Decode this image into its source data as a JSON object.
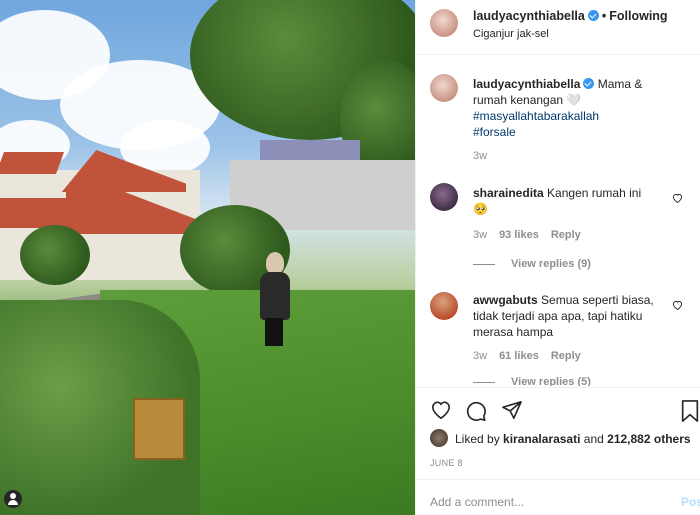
{
  "photo": {
    "alt_person_icon": "person-tag-icon"
  },
  "header": {
    "username": "laudyacynthiabella",
    "separator": "•",
    "follow_status": "Following",
    "location": "Ciganjur jak-sel"
  },
  "caption": {
    "username": "laudyacynthiabella",
    "text": "Mama & rumah kenangan 🤍",
    "hashtag1": "#masyallahtabarakallah",
    "hashtag2": "#forsale",
    "time": "3w"
  },
  "comments": [
    {
      "username": "sharainedita",
      "text": "Kangen rumah ini",
      "emoji": "🥺",
      "time": "3w",
      "likes": "93 likes",
      "reply": "Reply",
      "view_replies": "View replies (9)"
    },
    {
      "username": "awwgabuts",
      "text": "Semua seperti biasa, tidak terjadi apa apa, tapi hatiku merasa hampa",
      "time": "3w",
      "likes": "61 likes",
      "reply": "Reply",
      "view_replies": "View replies (5)"
    }
  ],
  "likes": {
    "prefix": "Liked by",
    "user": "kiranalarasati",
    "joiner": "and",
    "others": "212,882 others"
  },
  "date": "JUNE 8",
  "add_comment": {
    "placeholder": "Add a comment...",
    "post_label": "Post"
  }
}
